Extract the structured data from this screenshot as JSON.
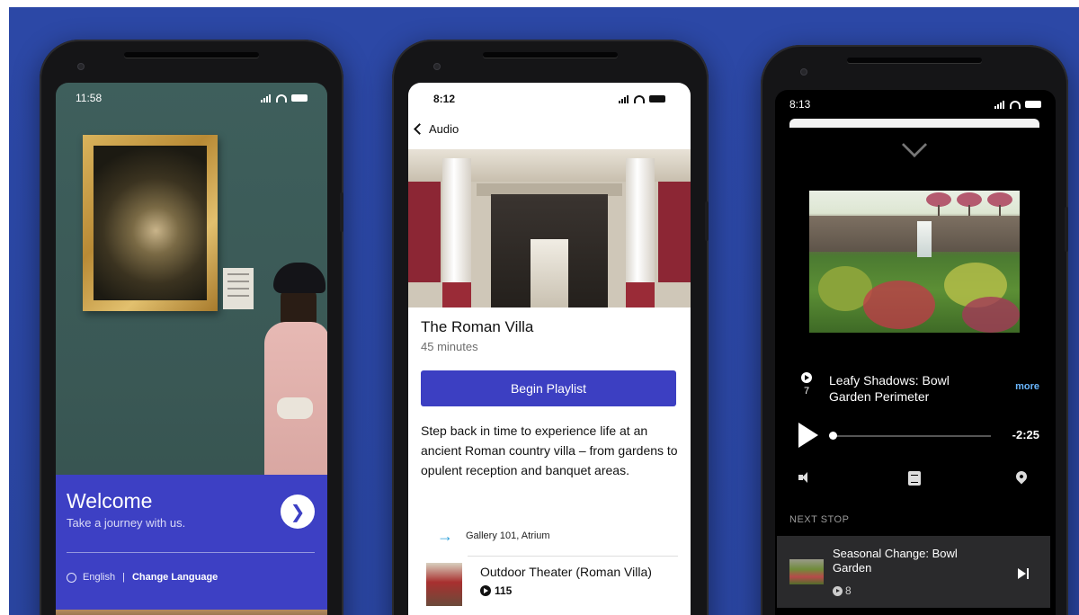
{
  "phone1": {
    "status": {
      "time": "11:58"
    },
    "welcome": {
      "title": "Welcome",
      "subtitle": "Take a journey with us.",
      "language": "English",
      "separator": "|",
      "change_language": "Change Language"
    },
    "icons": {
      "next": "chevron-right-icon",
      "language": "globe-icon"
    }
  },
  "phone2": {
    "status": {
      "time": "8:12"
    },
    "back_label": "Audio",
    "tour": {
      "title": "The Roman Villa",
      "duration": "45 minutes",
      "cta": "Begin Playlist",
      "description": "Step back in time to experience life at an ancient Roman country villa – from gardens to opulent reception and banquet areas."
    },
    "stops": [
      {
        "location": "Gallery 101, Atrium"
      },
      {
        "name": "Outdoor Theater (Roman Villa)",
        "number": "115"
      }
    ],
    "accent": "#3c3fc2"
  },
  "phone3": {
    "status": {
      "time": "8:13"
    },
    "now_playing": {
      "track_number": "7",
      "title": "Leafy Shadows: Bowl Garden Perimeter",
      "more": "more",
      "remaining": "-2:25",
      "progress": 0.02
    },
    "next_stop": {
      "label": "NEXT STOP",
      "title": "Seasonal Change: Bowl Garden",
      "number": "8"
    },
    "accent": "#6ab7ff"
  }
}
